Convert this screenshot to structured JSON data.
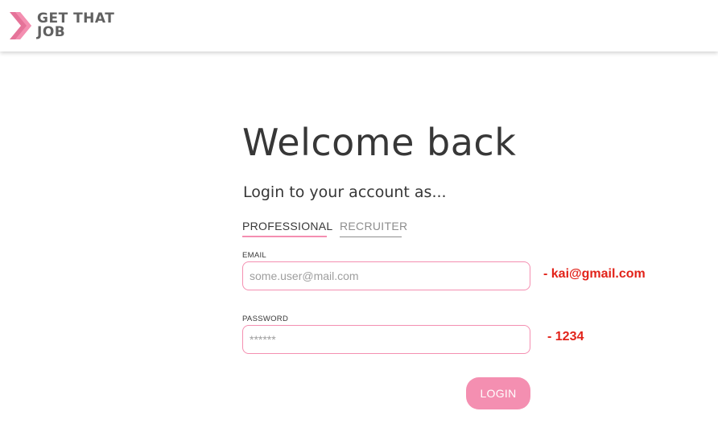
{
  "header": {
    "logo": {
      "line1": "GET THAT",
      "line2": "JOB",
      "icon": "chevron-right-icon"
    }
  },
  "login": {
    "title": "Welcome back",
    "subtitle": "Login to your account as...",
    "tabs": [
      {
        "label": "PROFESSIONAL",
        "active": true
      },
      {
        "label": "RECRUITER",
        "active": false
      }
    ],
    "email": {
      "label": "EMAIL",
      "placeholder": "some.user@mail.com",
      "value": ""
    },
    "password": {
      "label": "PASSWORD",
      "placeholder": "******",
      "value": ""
    },
    "submit_label": "LOGIN"
  },
  "annotations": {
    "email_note": "- kai@gmail.com",
    "password_note": "- 1234"
  },
  "colors": {
    "accent": "#f48fb1",
    "text": "#373737",
    "muted": "#8e8e8e",
    "annotation": "#e2231a"
  }
}
